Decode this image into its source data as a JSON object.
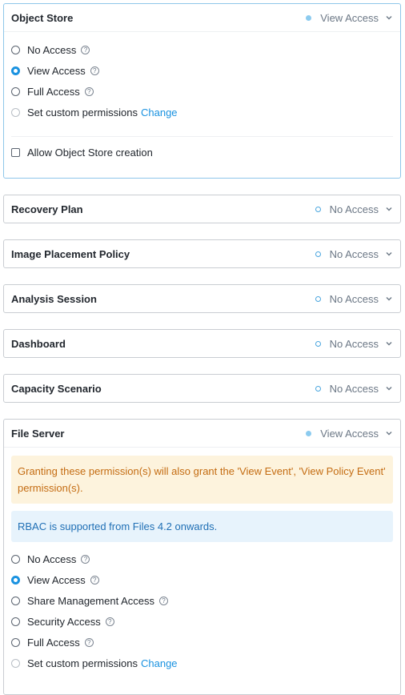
{
  "object_store": {
    "title": "Object Store",
    "status": "View Access",
    "options": [
      {
        "label": "No Access",
        "help": "?"
      },
      {
        "label": "View Access",
        "help": "?"
      },
      {
        "label": "Full Access",
        "help": "?"
      },
      {
        "label": "Set custom permissions",
        "link": "Change"
      }
    ],
    "checkbox_label": "Allow Object Store creation"
  },
  "collapsed": [
    {
      "title": "Recovery Plan",
      "status": "No Access"
    },
    {
      "title": "Image Placement Policy",
      "status": "No Access"
    },
    {
      "title": "Analysis Session",
      "status": "No Access"
    },
    {
      "title": "Dashboard",
      "status": "No Access"
    },
    {
      "title": "Capacity Scenario",
      "status": "No Access"
    }
  ],
  "file_server": {
    "title": "File Server",
    "status": "View Access",
    "warning": "Granting these permission(s) will also grant the 'View Event', 'View Policy Event' permission(s).",
    "info": "RBAC is supported from Files 4.2 onwards.",
    "options": [
      {
        "label": "No Access",
        "help": "?"
      },
      {
        "label": "View Access",
        "help": "?"
      },
      {
        "label": "Share Management Access",
        "help": "?"
      },
      {
        "label": "Security Access",
        "help": "?"
      },
      {
        "label": "Full Access",
        "help": "?"
      },
      {
        "label": "Set custom permissions",
        "link": "Change"
      }
    ]
  },
  "colors": {
    "accent": "#1a92e0",
    "warning_bg": "#fdf3dd",
    "warning_text": "#c46c12",
    "info_bg": "#e7f3fc",
    "info_text": "#1f6fb5"
  }
}
